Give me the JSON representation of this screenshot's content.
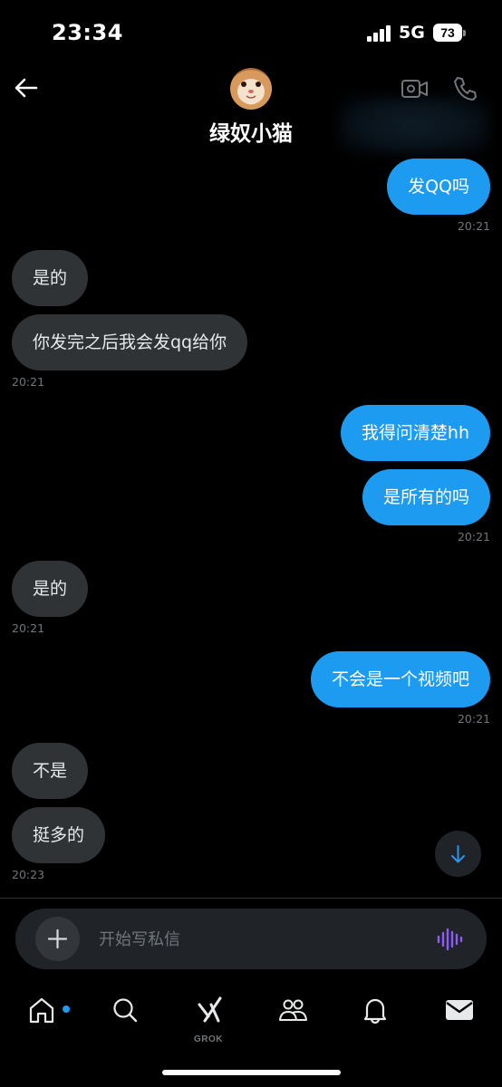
{
  "status_bar": {
    "time": "23:34",
    "network": "5G",
    "battery": "73"
  },
  "header": {
    "contact_name": "绿奴小猫"
  },
  "messages": [
    {
      "direction": "out",
      "text": "发QQ吗",
      "time": "20:21"
    },
    {
      "direction": "in",
      "text": "是的",
      "time": ""
    },
    {
      "direction": "in",
      "text": "你发完之后我会发qq给你",
      "time": "20:21"
    },
    {
      "direction": "out",
      "text": "我得问清楚hh",
      "time": ""
    },
    {
      "direction": "out",
      "text": "是所有的吗",
      "time": "20:21"
    },
    {
      "direction": "in",
      "text": "是的",
      "time": "20:21"
    },
    {
      "direction": "out",
      "text": "不会是一个视频吧",
      "time": "20:21"
    },
    {
      "direction": "in",
      "text": "不是",
      "time": ""
    },
    {
      "direction": "in",
      "text": "挺多的",
      "time": "20:23"
    }
  ],
  "composer": {
    "placeholder": "开始写私信"
  },
  "nav": {
    "grok_label": "GROK"
  },
  "colors": {
    "accent": "#1d9bf0",
    "incoming_bubble": "#2f3336",
    "voice_icon": "#8b5cf6"
  },
  "icons": {
    "back": "arrow-left-icon",
    "video_call": "video-camera-icon",
    "call": "phone-icon",
    "scroll_down": "arrow-down-icon",
    "attach": "plus-icon",
    "voice": "voice-waveform-icon",
    "tabs": [
      "home-icon",
      "search-icon",
      "grok-icon",
      "communities-icon",
      "notifications-icon",
      "messages-icon"
    ]
  }
}
